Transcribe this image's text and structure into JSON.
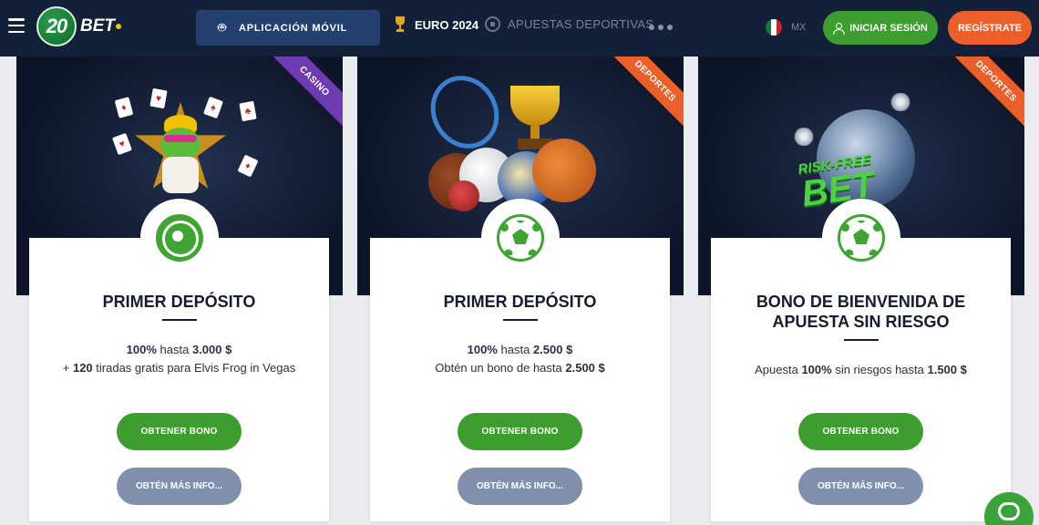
{
  "header": {
    "logo_text": "20BET",
    "app_button_label": "APLICACIÓN MÓVIL",
    "euro_label": "EURO 2024",
    "sports_label": "APUESTAS DEPORTIVAS",
    "lang_label": "MX",
    "login_label": "INICIAR SESIÓN",
    "register_label": "REGÍSTRATE",
    "colors": {
      "background": "#12203a",
      "login": "#3e9d2f",
      "register": "#ec5f2a",
      "app_button": "#24406f"
    }
  },
  "cards": [
    {
      "ribbon": "CASINO",
      "ribbon_color": "#6e3bb0",
      "icon": "roulette-icon",
      "title": "PRIMER DEPÓSITO",
      "line1_bold": "100%",
      "line1_text": " hasta ",
      "line1_bold2": "3.000 $",
      "line2_prefix": "+ ",
      "line2_bold": "120",
      "line2_text": " tiradas gratis para Elvis Frog in Vegas",
      "bonus_label": "OBTENER BONO",
      "info_label": "OBTÉN MÁS INFO..."
    },
    {
      "ribbon": "DEPORTES",
      "ribbon_color": "#ec5f2a",
      "icon": "soccer-ball-icon",
      "title": "PRIMER DEPÓSITO",
      "line1_bold": "100%",
      "line1_text": " hasta ",
      "line1_bold2": "2.500 $",
      "line2_text": "Obtén un bono de hasta ",
      "line2_bold": "2.500 $",
      "bonus_label": "OBTENER BONO",
      "info_label": "OBTÉN MÁS INFO..."
    },
    {
      "ribbon": "DEPORTES",
      "ribbon_color": "#ec5f2a",
      "icon": "soccer-ball-icon",
      "title_line1": "BONO DE BIENVENIDA DE",
      "title_line2": "APUESTA SIN RIESGO",
      "desc_text1": "Apuesta ",
      "desc_bold1": "100%",
      "desc_text2": " sin riesgos hasta ",
      "desc_bold2": "1.500 $",
      "hero_text_small": "RISK-FREE",
      "hero_text_big": "BET",
      "bonus_label": "OBTENER BONO",
      "info_label": "OBTÉN MÁS INFO..."
    }
  ]
}
